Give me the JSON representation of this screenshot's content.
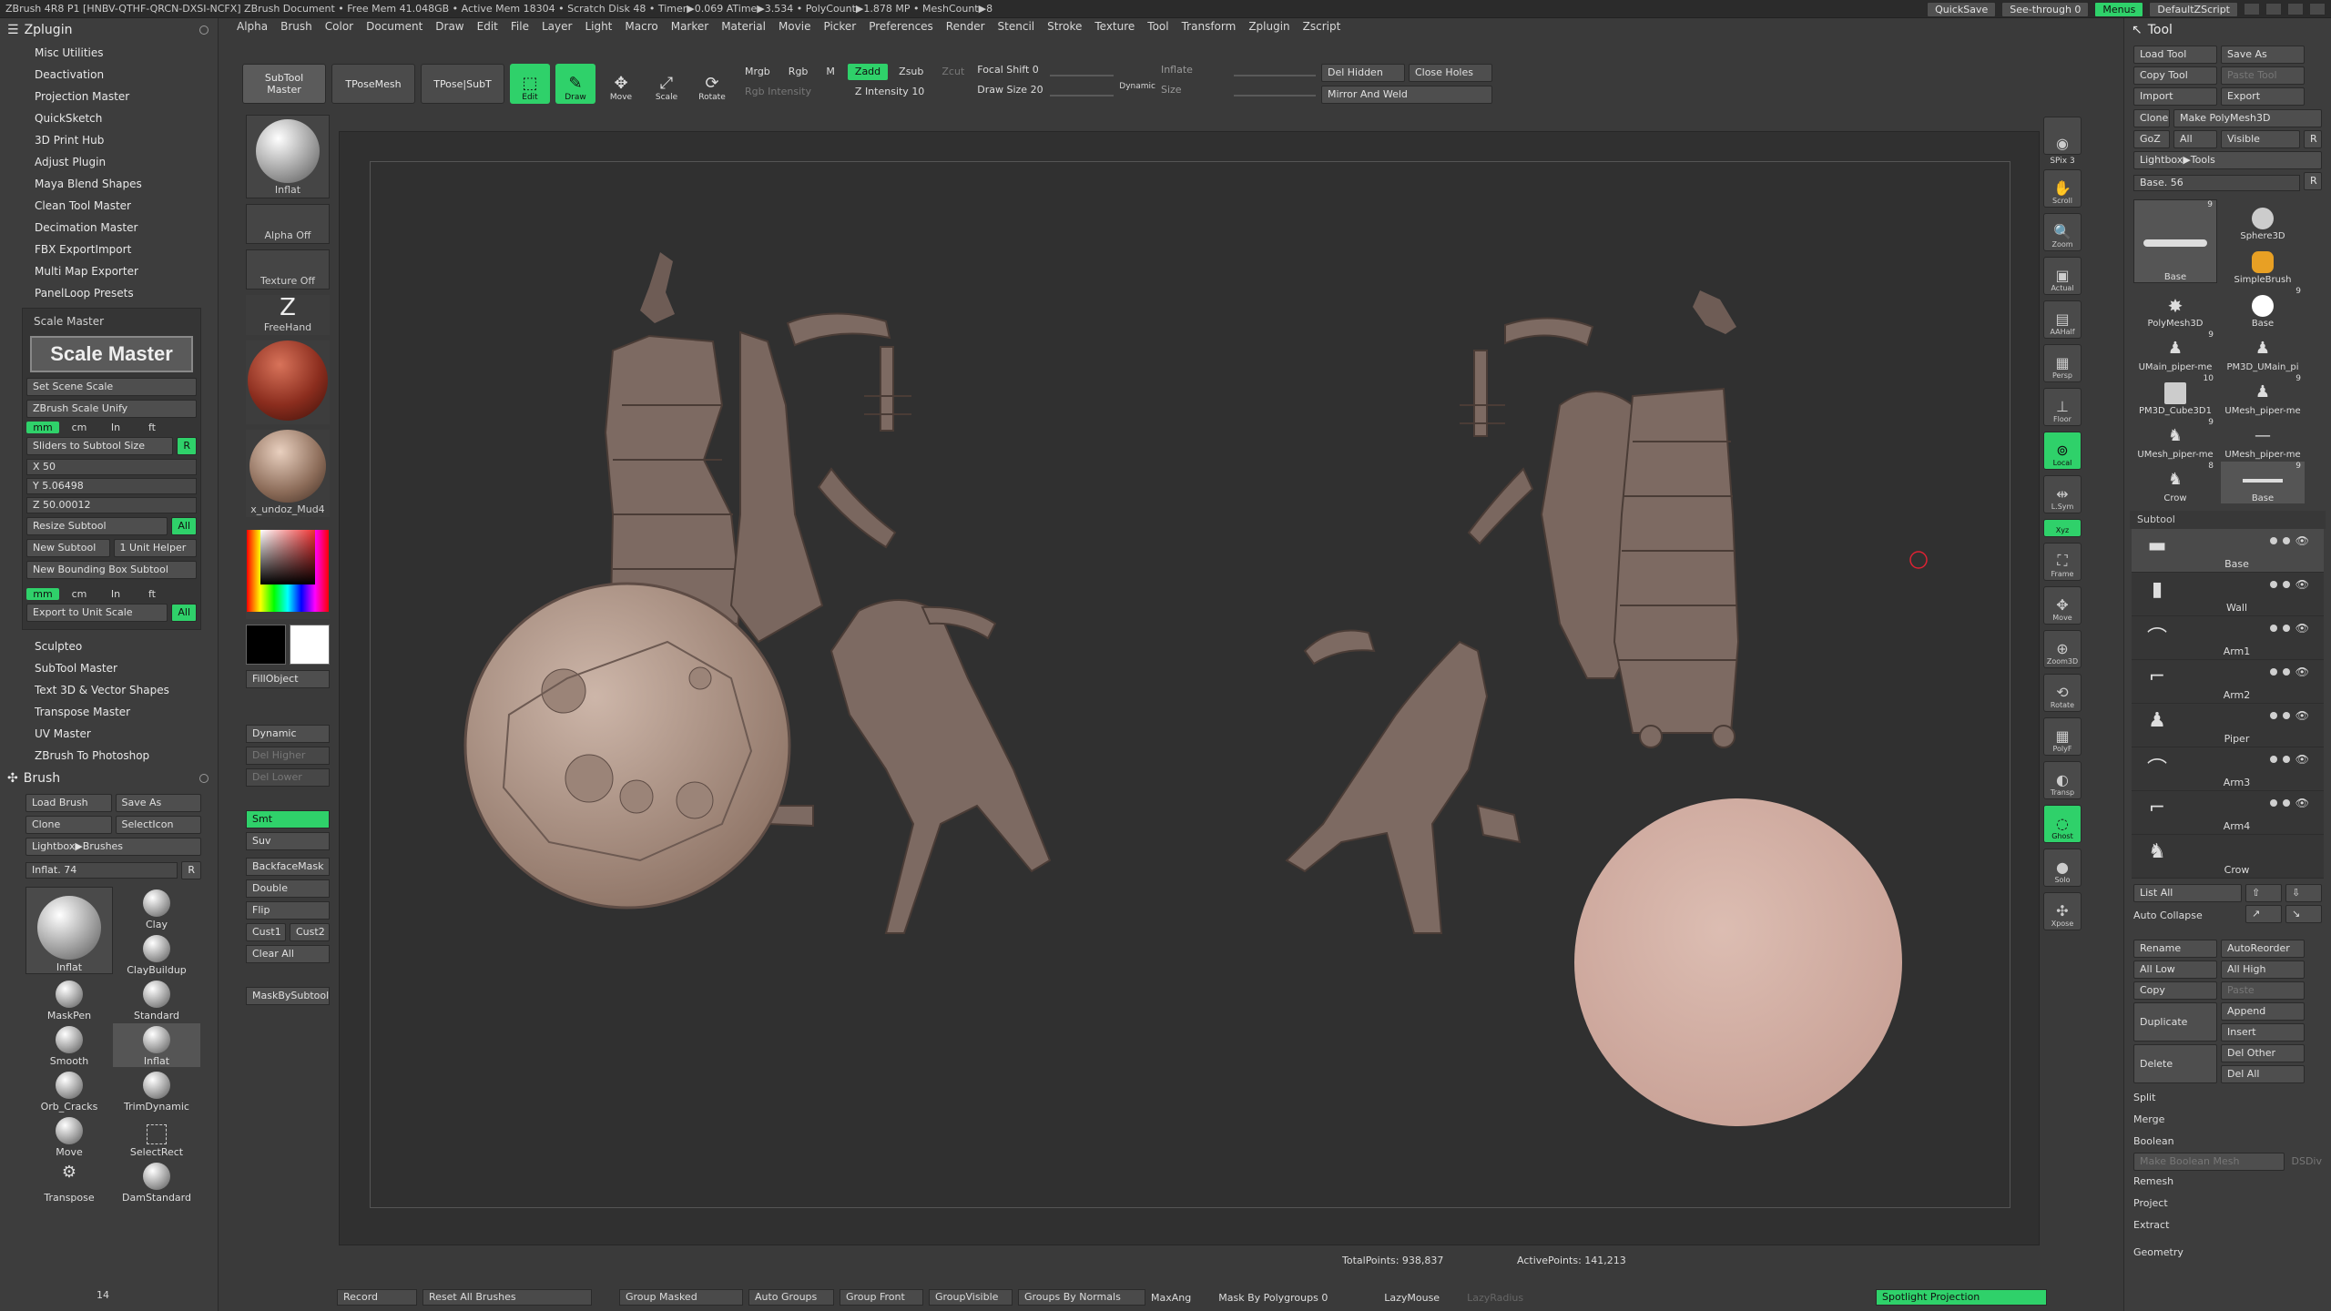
{
  "titlebar": {
    "status": "ZBrush 4R8 P1 [HNBV-QTHF-QRCN-DXSI-NCFX]  ZBrush Document    • Free Mem 41.048GB • Active Mem 18304 • Scratch Disk 48 • Timer▶0.069 ATime▶3.534 • PolyCount▶1.878 MP • MeshCount▶8",
    "quicksave": "QuickSave",
    "see_through": "See-through 0",
    "menus": "Menus",
    "default_zscript": "DefaultZScript"
  },
  "menubar": [
    "Alpha",
    "Brush",
    "Color",
    "Document",
    "Draw",
    "Edit",
    "File",
    "Layer",
    "Light",
    "Macro",
    "Marker",
    "Material",
    "Movie",
    "Picker",
    "Preferences",
    "Render",
    "Stencil",
    "Stroke",
    "Texture",
    "Tool",
    "Transform",
    "Zplugin",
    "Zscript"
  ],
  "zplugin": {
    "title": "Zplugin",
    "items_top": [
      "Misc Utilities",
      "Deactivation",
      "Projection Master",
      "QuickSketch",
      "3D Print Hub",
      "Adjust Plugin",
      "Maya Blend Shapes",
      "Clean Tool Master",
      "Decimation Master",
      "FBX ExportImport",
      "Multi Map Exporter",
      "PanelLoop Presets"
    ],
    "scale_master": {
      "label": "Scale Master",
      "logo": "Scale Master",
      "set_scene_scale": "Set Scene Scale",
      "zbrush_scale_unify": "ZBrush Scale Unify",
      "units": [
        "mm",
        "cm",
        "In",
        "ft"
      ],
      "sliders_to_subtool": "Sliders to Subtool Size",
      "r": "R",
      "x": "X 50",
      "y": "Y 5.06498",
      "z": "Z 50.00012",
      "resize_subtool": "Resize Subtool",
      "all": "All",
      "new_subtool": "New Subtool",
      "unit_helper": "1 Unit Helper",
      "new_bbox_subtool": "New Bounding Box Subtool",
      "export_to_unit_scale": "Export to Unit Scale"
    },
    "items_bottom": [
      "Sculpteo",
      "SubTool Master",
      "Text 3D & Vector Shapes",
      "Transpose Master",
      "UV Master",
      "ZBrush To Photoshop"
    ]
  },
  "brush": {
    "title": "Brush",
    "load_brush": "Load Brush",
    "save_as": "Save As",
    "clone": "Clone",
    "select_icon": "SelectIcon",
    "lightbox": "Lightbox▶Brushes",
    "inflat_slider": "Inflat. 74",
    "r": "R",
    "current": "Inflat",
    "list": [
      "Clay",
      "ClayBuildup",
      "Standard",
      "MaskPen",
      "Smooth",
      "Inflat",
      "Orb_Cracks",
      "TrimDynamic",
      "Move",
      "SelectRect",
      "Transpose",
      "DamStandard"
    ],
    "count": "14"
  },
  "shelf": {
    "inflat": "Inflat",
    "alpha_off": "Alpha Off",
    "texture_off": "Texture Off",
    "freehand": "FreeHand",
    "material": "x_undoz_Mud4",
    "fill_object": "FillObject",
    "dynamic": "Dynamic",
    "del_higher": "Del Higher",
    "del_lower": "Del Lower",
    "smt": "Smt",
    "suv": "Suv",
    "backface_mask": "BackfaceMask",
    "double": "Double",
    "flip": "Flip",
    "cust1": "Cust1",
    "cust2": "Cust2",
    "clear_all": "Clear All",
    "mask_by_subtool": "MaskBySubtool"
  },
  "toolbar": {
    "subtool_master": "SubTool Master",
    "tpose_mesh": "TPoseMesh",
    "tpose_subt": "TPose|SubT",
    "edit": "Edit",
    "draw": "Draw",
    "move": "Move",
    "scale": "Scale",
    "rotate": "Rotate",
    "mrgb": "Mrgb",
    "rgb": "Rgb",
    "m": "M",
    "rgb_intensity": "Rgb Intensity",
    "zadd": "Zadd",
    "zsub": "Zsub",
    "zcut": "Zcut",
    "z_intensity": "Z Intensity 10",
    "focal_shift": "Focal Shift 0",
    "draw_size": "Draw Size 20",
    "dynamic": "Dynamic",
    "inflate": "Inflate",
    "size": "Size",
    "del_hidden": "Del Hidden",
    "close_holes": "Close Holes",
    "mirror_and_weld": "Mirror And Weld"
  },
  "right_icons": [
    "SPix 3",
    "Scroll",
    "Zoom",
    "Actual",
    "AAHalf",
    "Persp",
    "Floor",
    "Local",
    "L.Sym",
    "Xyz",
    "Frame",
    "Move",
    "Zoom3D",
    "Rotate",
    "PolyF",
    "Transp",
    "Ghost",
    "Solo",
    "Xpose"
  ],
  "viewport": {
    "total_points": "TotalPoints: 938,837",
    "active_points": "ActivePoints: 141,213"
  },
  "tool": {
    "title": "Tool",
    "load_tool": "Load Tool",
    "save_as": "Save As",
    "copy_tool": "Copy Tool",
    "paste_tool": "Paste Tool",
    "import": "Import",
    "export": "Export",
    "clone": "Clone",
    "make_polymesh": "Make PolyMesh3D",
    "goz": "GoZ",
    "all": "All",
    "visible": "Visible",
    "r": "R",
    "lightbox": "Lightbox▶Tools",
    "base_slider": "Base. 56",
    "thumbs": [
      {
        "name": "Base",
        "num": "9"
      },
      {
        "name": "Sphere3D",
        "num": ""
      },
      {
        "name": "SimpleBrush",
        "num": ""
      },
      {
        "name": "PolyMesh3D",
        "num": ""
      },
      {
        "name": "Base",
        "num": "9"
      },
      {
        "name": "UMain_piper-me",
        "num": "9"
      },
      {
        "name": "PM3D_UMain_pi",
        "num": ""
      },
      {
        "name": "PM3D_Cube3D1",
        "num": "10"
      },
      {
        "name": "UMesh_piper-me",
        "num": "9"
      },
      {
        "name": "UMesh_piper-me",
        "num": "9"
      },
      {
        "name": "UMesh_piper-me",
        "num": ""
      },
      {
        "name": "Crow",
        "num": "8"
      },
      {
        "name": "Base",
        "num": "9"
      }
    ],
    "subtool": {
      "header": "Subtool",
      "items": [
        "Base",
        "Wall",
        "Arm1",
        "Arm2",
        "Piper",
        "Arm3",
        "Arm4",
        "Crow"
      ]
    },
    "list_all": "List All",
    "auto_collapse": "Auto Collapse",
    "rename": "Rename",
    "auto_reorder": "AutoReorder",
    "all_low": "All Low",
    "all_high": "All High",
    "copy": "Copy",
    "paste": "Paste",
    "duplicate": "Duplicate",
    "append": "Append",
    "insert": "Insert",
    "delete": "Delete",
    "del_other": "Del Other",
    "del_all": "Del All",
    "split": "Split",
    "merge": "Merge",
    "boolean": "Boolean",
    "make_boolean_mesh": "Make Boolean Mesh",
    "dsdiv": "DSDiv",
    "remesh": "Remesh",
    "project": "Project",
    "extract": "Extract",
    "geometry": "Geometry"
  },
  "bottombar": {
    "record": "Record",
    "reset_all_brushes": "Reset All Brushes",
    "group_masked": "Group Masked",
    "auto_groups": "Auto Groups",
    "group_front": "Group Front",
    "group_visible": "GroupVisible",
    "groups_by_normals": "Groups By Normals",
    "max_angle": "MaxAng",
    "mask_by_polygroups": "Mask By Polygroups 0",
    "lazy_mouse": "LazyMouse",
    "lazy_radius": "LazyRadius",
    "spotlight_projection": "Spotlight Projection"
  },
  "colors": {
    "accent_green": "#2fd16a",
    "panel_bg": "#3d3d3d",
    "viewport_bg": "#303030",
    "model_color": "#7d6a62",
    "base_disc_color": "#d2b2a8"
  }
}
